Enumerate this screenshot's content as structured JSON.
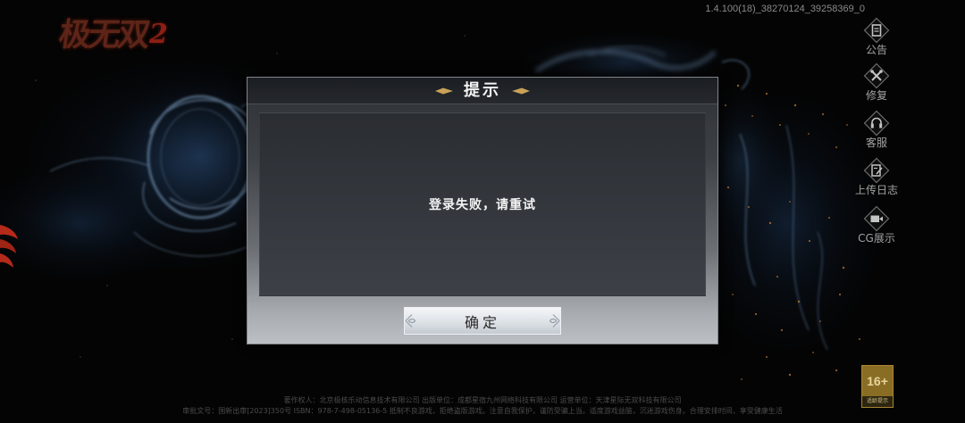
{
  "app": {
    "version": "1.4.100(18)_38270124_39258369_0"
  },
  "logo": {
    "text": "极无双",
    "number": "2"
  },
  "side_menu": {
    "items": [
      {
        "icon": "notice-icon",
        "label": "公告"
      },
      {
        "icon": "repair-icon",
        "label": "修复"
      },
      {
        "icon": "customer-service-icon",
        "label": "客服"
      },
      {
        "icon": "upload-log-icon",
        "label": "上传日志"
      },
      {
        "icon": "cg-video-icon",
        "label": "CG展示"
      }
    ]
  },
  "dialog": {
    "title": "提示",
    "message": "登录失败，请重试",
    "confirm_label": "确定"
  },
  "footer": {
    "line1": "著作权人：北京极核乐动信息技术有限公司  出版单位：成都星宿九州网络科技有限公司  运营单位：天津星际无双科技有限公司",
    "line2": "审批文号：国新出审[2023]350号  ISBN：978-7-498-05136-5  抵制不良游戏，拒绝盗版游戏。注意自我保护，谨防受骗上当。适度游戏益脑，沉迷游戏伤身。合理安排时间，享受健康生活"
  },
  "age_rating": {
    "label": "16+",
    "caption": "适龄提示"
  },
  "colors": {
    "background": "#040404",
    "logo": "#5e2418",
    "dialog_header": "#1d2024",
    "message_panel": "#30343a",
    "button": "#dde2e7",
    "ornament_gold": "#c8a257",
    "menu_label": "#a3a3a3",
    "age_badge": "#8a6d25"
  }
}
